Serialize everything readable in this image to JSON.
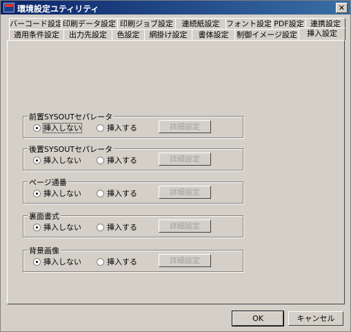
{
  "window": {
    "title": "環境設定ユティリティ",
    "close_label": "✕",
    "app_icon": "app-logo-icon"
  },
  "tabs": {
    "row1": [
      "バーコード設定",
      "印刷データ設定",
      "印刷ジョブ設定",
      "連続紙設定",
      "フォント設定",
      "PDF設定",
      "連携設定"
    ],
    "row2": [
      "適用条件設定",
      "出力先設定",
      "色設定",
      "網掛け設定",
      "書体設定",
      "制御イメージ設定",
      "挿入設定"
    ],
    "active": "挿入設定"
  },
  "groups": [
    {
      "title": "前置SYSOUTセパレータ",
      "option_no": "挿入しない",
      "option_yes": "挿入する",
      "detail": "詳細設定"
    },
    {
      "title": "後置SYSOUTセパレータ",
      "option_no": "挿入しない",
      "option_yes": "挿入する",
      "detail": "詳細設定"
    },
    {
      "title": "ページ通番",
      "option_no": "挿入しない",
      "option_yes": "挿入する",
      "detail": "詳細設定"
    },
    {
      "title": "裏面書式",
      "option_no": "挿入しない",
      "option_yes": "挿入する",
      "detail": "詳細設定"
    },
    {
      "title": "背景画像",
      "option_no": "挿入しない",
      "option_yes": "挿入する",
      "detail": "詳細設定"
    }
  ],
  "buttons": {
    "ok": "OK",
    "cancel": "キャンセル"
  }
}
